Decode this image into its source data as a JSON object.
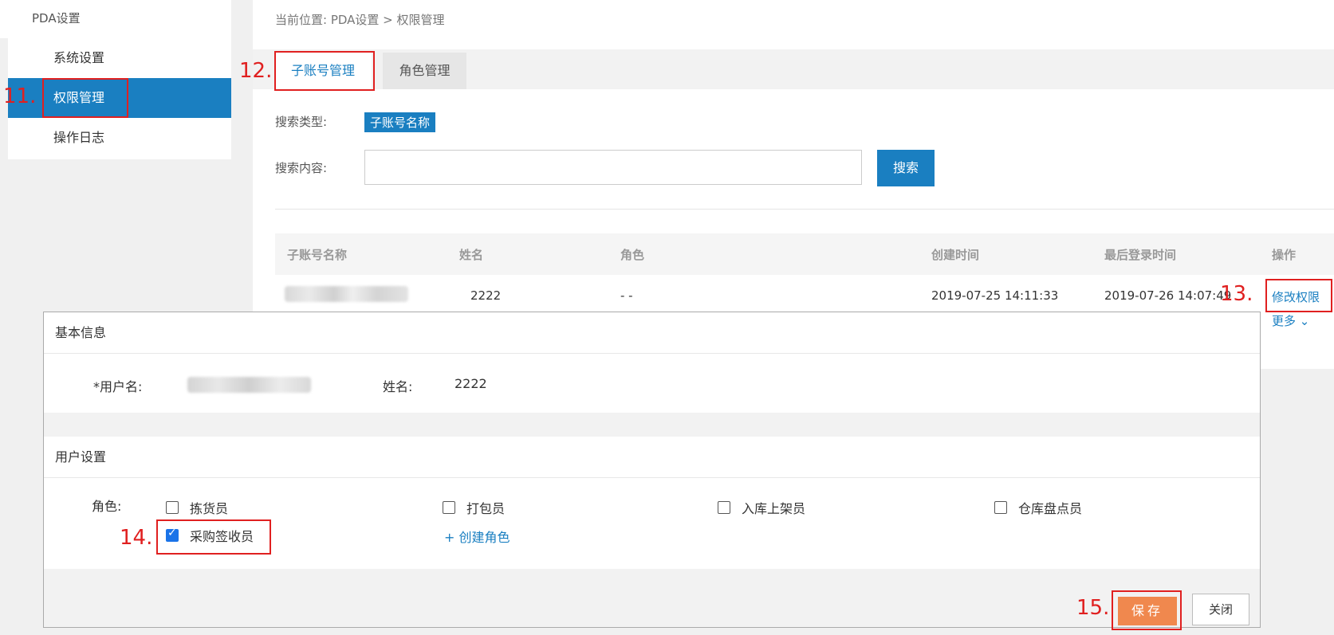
{
  "sidebar": {
    "title": "PDA设置",
    "items": [
      {
        "label": "系统设置",
        "active": false
      },
      {
        "label": "权限管理",
        "active": true
      },
      {
        "label": "操作日志",
        "active": false
      }
    ]
  },
  "breadcrumb": "当前位置:  PDA设置 > 权限管理",
  "tabs": [
    {
      "label": "子账号管理",
      "active": true
    },
    {
      "label": "角色管理",
      "active": false
    }
  ],
  "search": {
    "type_label": "搜索类型:",
    "type_value": "子账号名称",
    "content_label": "搜索内容:",
    "placeholder": "",
    "button_label": "搜索"
  },
  "table": {
    "headers": [
      "子账号名称",
      "姓名",
      "角色",
      "创建时间",
      "最后登录时间",
      "操作"
    ],
    "rows": [
      {
        "account": "",
        "name": "2222",
        "role": "- -",
        "created": "2019-07-25 14:11:33",
        "last_login": "2019-07-26 14:07:49",
        "action": "修改权限",
        "more": "更多 ⌄"
      }
    ]
  },
  "dialog": {
    "basic_info_title": "基本信息",
    "username_label": "*用户名:",
    "name_label": "姓名:",
    "name_value": "2222",
    "user_settings_title": "用户设置",
    "role_label": "角色:",
    "roles": [
      {
        "label": "拣货员",
        "checked": false
      },
      {
        "label": "打包员",
        "checked": false
      },
      {
        "label": "入库上架员",
        "checked": false
      },
      {
        "label": "仓库盘点员",
        "checked": false
      },
      {
        "label": "采购签收员",
        "checked": true
      }
    ],
    "create_role_link": "+ 创建角色",
    "save_label": "保存",
    "close_label": "关闭"
  },
  "annotations": [
    "11.",
    "12.",
    "13.",
    "14.",
    "15."
  ],
  "colors": {
    "accent": "#1a7fc1",
    "save": "#f0884e",
    "annotation": "#e02020"
  }
}
